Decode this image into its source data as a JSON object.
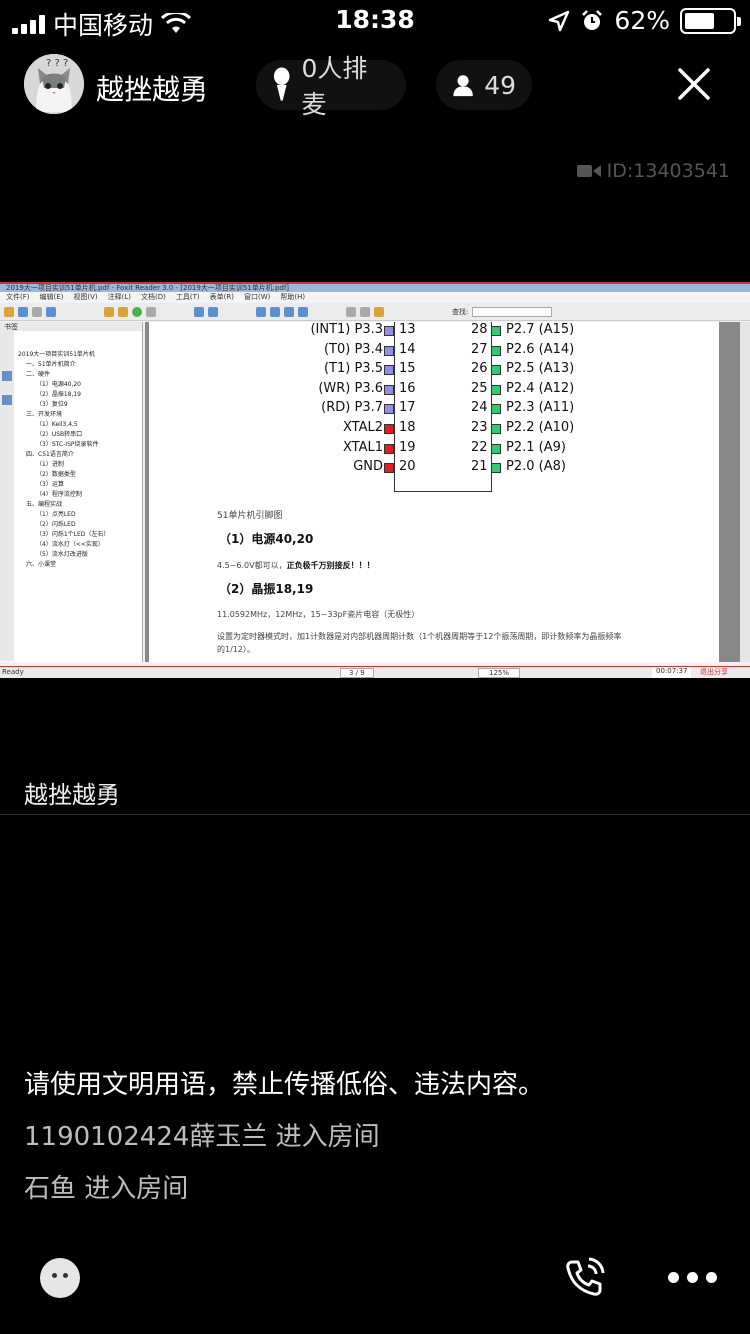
{
  "status_bar": {
    "carrier": "中国移动",
    "time": "18:38",
    "battery_percent": "62%",
    "battery_level": 0.62
  },
  "room": {
    "name": "越挫越勇",
    "mic_queue": "0人排麦",
    "member_count": "49",
    "room_id": "ID:13403541"
  },
  "shared_screen": {
    "window_title": "2019大一项目实训51单片机.pdf - Foxit Reader 3.0 - [2019大一项目实训51单片机.pdf]",
    "menu": [
      "文件(F)",
      "编辑(E)",
      "视图(V)",
      "注释(L)",
      "文档(D)",
      "工具(T)",
      "表单(R)",
      "窗口(W)",
      "帮助(H)"
    ],
    "search_label": "查找:",
    "bookmark_tab": "书签",
    "bookmarks": [
      "2019大一项目实训51单片机",
      "一、51单片机简介",
      "二、硬件",
      "（1）电源40,20",
      "（2）晶振18,19",
      "（3）复位9",
      "三、开发环境",
      "（1）Keil3,4,5",
      "（2）USB转串口",
      "（3）STC-ISP烧录软件",
      "四、C51语言简介",
      "（1）进制",
      "（2）数据类型",
      "（3）运算",
      "（4）程序流控制",
      "五、编程实战",
      "（1）点亮LED",
      "（2）闪烁LED",
      "（3）闪烁1个LED（左右）",
      "（4）流水灯（<<实现）",
      "（5）流水灯改进版",
      "六、小课堂"
    ],
    "pins": [
      {
        "left_label": "(INT1) P3.3",
        "left_num": "13",
        "left_color": "#8f8fe8",
        "right_num": "28",
        "right_label": "P2.7 (A15)",
        "right_color": "#2ecc71"
      },
      {
        "left_label": "(T0) P3.4",
        "left_num": "14",
        "left_color": "#8f8fe8",
        "right_num": "27",
        "right_label": "P2.6 (A14)",
        "right_color": "#2ecc71"
      },
      {
        "left_label": "(T1) P3.5",
        "left_num": "15",
        "left_color": "#8f8fe8",
        "right_num": "26",
        "right_label": "P2.5 (A13)",
        "right_color": "#2ecc71"
      },
      {
        "left_label": "(WR) P3.6",
        "left_num": "16",
        "left_color": "#8f8fe8",
        "right_num": "25",
        "right_label": "P2.4 (A12)",
        "right_color": "#2ecc71"
      },
      {
        "left_label": "(RD) P3.7",
        "left_num": "17",
        "left_color": "#8f8fe8",
        "right_num": "24",
        "right_label": "P2.3 (A11)",
        "right_color": "#2ecc71"
      },
      {
        "left_label": "XTAL2",
        "left_num": "18",
        "left_color": "#e02020",
        "right_num": "23",
        "right_label": "P2.2 (A10)",
        "right_color": "#2ecc71"
      },
      {
        "left_label": "XTAL1",
        "left_num": "19",
        "left_color": "#e02020",
        "right_num": "22",
        "right_label": "P2.1 (A9)",
        "right_color": "#2ecc71"
      },
      {
        "left_label": "GND",
        "left_num": "20",
        "left_color": "#e02020",
        "right_num": "21",
        "right_label": "P2.0 (A8)",
        "right_color": "#2ecc71"
      }
    ],
    "caption": "51单片机引脚图",
    "heading1": "（1）电源40,20",
    "para1_normal": "4.5~6.0V都可以，",
    "para1_bold": "正负极千万别接反！！！",
    "heading2": "（2）晶振18,19",
    "para2": "11.0592MHz，12MHz，15~33pF瓷片电容（无极性）",
    "para3_line1": "设置为定时器模式时，加1计数器是对内部机器周期计数（1个机器周期等于12个振荡周期，即计数频率为晶振频率",
    "para3_line2": "的1/12）。",
    "status_ready": "Ready",
    "page_indicator": "3 / 9",
    "zoom": "125%",
    "rec_time": "00:07:37",
    "exit_share": "退出分享"
  },
  "host_label": "越挫越勇",
  "chat": [
    {
      "text": "请使用文明用语，禁止传播低俗、违法内容。",
      "kind": "notice"
    },
    {
      "text": "1190102424薛玉兰 进入房间",
      "kind": "event"
    },
    {
      "text": "石鱼 进入房间",
      "kind": "event"
    }
  ]
}
